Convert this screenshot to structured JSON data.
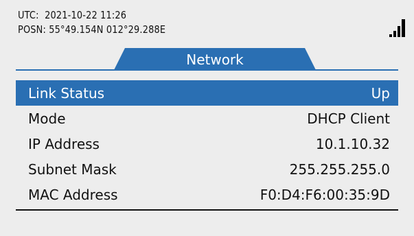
{
  "status": {
    "utc_label": "UTC:",
    "utc_value": "2021-10-22 11:26",
    "posn_label": "POSN:",
    "posn_value": "55°49.154N 012°29.288E",
    "signal_bars": 4
  },
  "tab": {
    "label": "Network"
  },
  "rows": [
    {
      "label": "Link Status",
      "value": "Up"
    },
    {
      "label": "Mode",
      "value": "DHCP Client"
    },
    {
      "label": "IP Address",
      "value": "10.1.10.32"
    },
    {
      "label": "Subnet Mask",
      "value": "255.255.255.0"
    },
    {
      "label": "MAC Address",
      "value": "F0:D4:F6:00:35:9D"
    }
  ],
  "colors": {
    "accent": "#2a6fb3",
    "background": "#ededed"
  }
}
